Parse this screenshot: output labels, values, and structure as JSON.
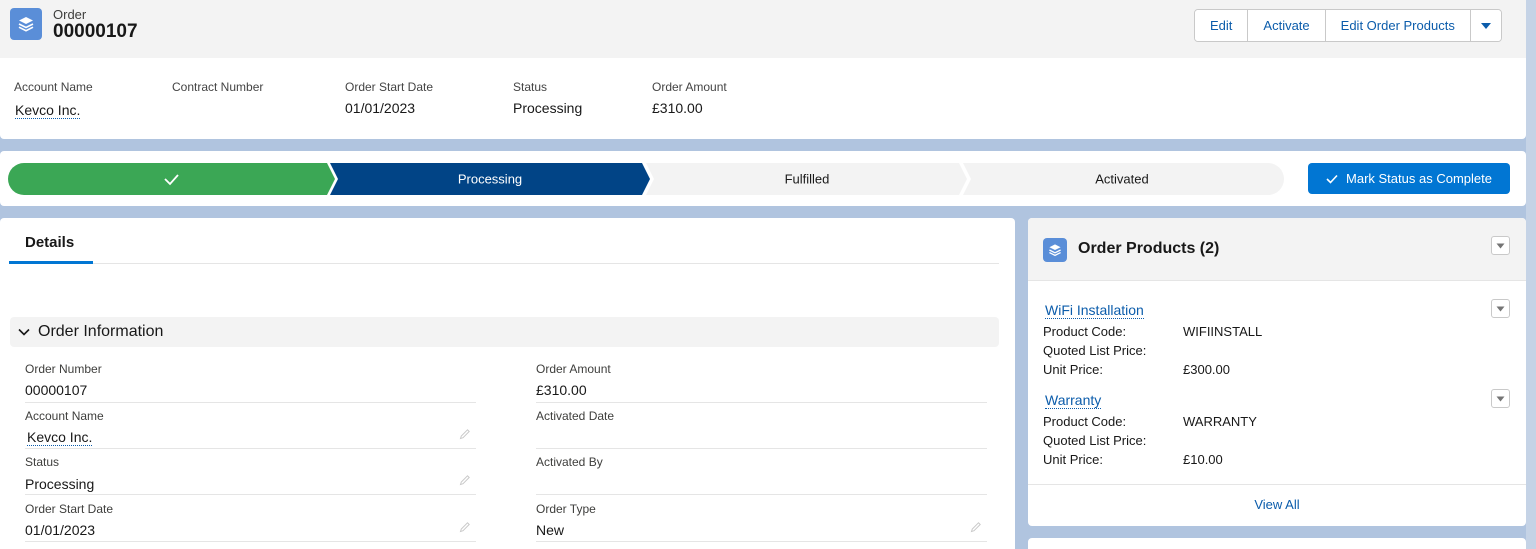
{
  "header": {
    "object_label": "Order",
    "record_title": "00000107",
    "actions": [
      "Edit",
      "Activate",
      "Edit Order Products"
    ]
  },
  "highlights": [
    {
      "label": "Account Name",
      "value": "Kevco Inc.",
      "is_link": true
    },
    {
      "label": "Contract Number",
      "value": "",
      "is_link": false
    },
    {
      "label": "Order Start Date",
      "value": "01/01/2023",
      "is_link": false
    },
    {
      "label": "Status",
      "value": "Processing",
      "is_link": false
    },
    {
      "label": "Order Amount",
      "value": "£310.00",
      "is_link": false
    }
  ],
  "path": {
    "stages": [
      "",
      "Processing",
      "Fulfilled",
      "Activated"
    ],
    "completed_index": 0,
    "current_index": 1,
    "button_label": "Mark Status as Complete",
    "colors": {
      "complete": "#3ba755",
      "current": "#014486",
      "upcoming": "#f3f3f3"
    }
  },
  "details": {
    "tab_label": "Details",
    "section_title": "Order Information",
    "fields": [
      {
        "label": "Order Number",
        "value": "00000107"
      },
      {
        "label": "Order Amount",
        "value": "£310.00"
      },
      {
        "label": "Account Name",
        "value": "Kevco Inc.",
        "is_link": true,
        "editable": true
      },
      {
        "label": "Activated Date",
        "value": ""
      },
      {
        "label": "Status",
        "value": "Processing",
        "editable": true
      },
      {
        "label": "Activated By",
        "value": ""
      },
      {
        "label": "Order Start Date",
        "value": "01/01/2023",
        "editable": true
      },
      {
        "label": "Order Type",
        "value": "New",
        "editable": true
      }
    ]
  },
  "order_products": {
    "title": "Order Products (2)",
    "items": [
      {
        "name": "WiFi Installation",
        "product_code_label": "Product Code:",
        "product_code": "WIFIINSTALL",
        "quoted_label": "Quoted List Price:",
        "quoted_value": "",
        "unit_label": "Unit Price:",
        "unit_price": "£300.00"
      },
      {
        "name": "Warranty",
        "product_code_label": "Product Code:",
        "product_code": "WARRANTY",
        "quoted_label": "Quoted List Price:",
        "quoted_value": "",
        "unit_label": "Unit Price:",
        "unit_price": "£10.00"
      }
    ],
    "view_all_label": "View All"
  },
  "colors": {
    "brand_button": "#0176d3",
    "link": "#0b5cab",
    "page_background": "#b0c4df"
  }
}
